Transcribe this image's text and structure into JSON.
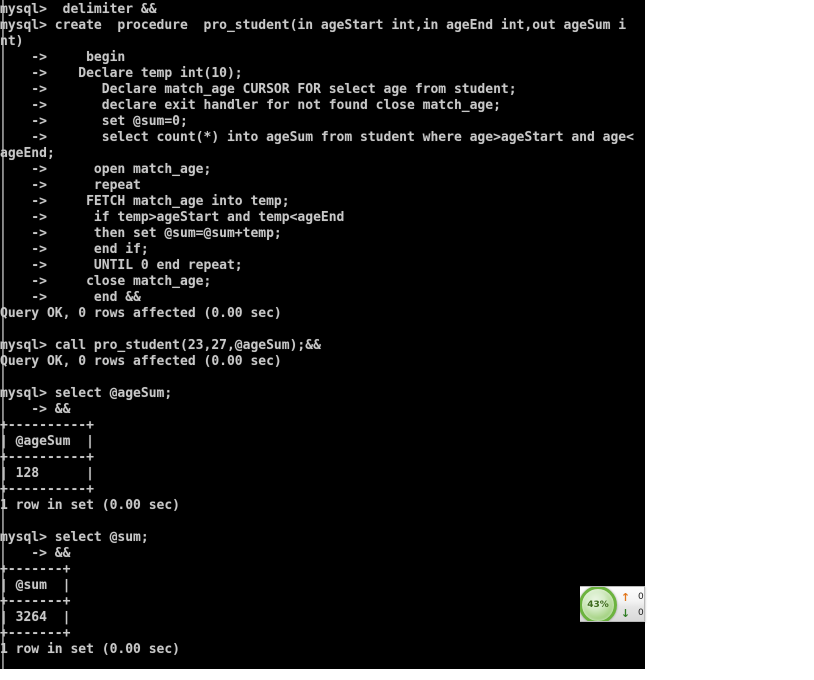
{
  "console": {
    "title": "mysql command line client",
    "prompt": "mysql>",
    "continuation_prompt": "->",
    "text_color": "#c8c8c8",
    "background_color": "#000000",
    "lines": [
      "mysql>  delimiter &&",
      "mysql> create  procedure  pro_student(in ageStart int,in ageEnd int,out ageSum i",
      "nt)",
      "    ->     begin",
      "    ->    Declare temp int(10);",
      "    ->       Declare match_age CURSOR FOR select age from student;",
      "    ->       declare exit handler for not found close match_age;",
      "    ->       set @sum=0;",
      "    ->       select count(*) into ageSum from student where age>ageStart and age<",
      "ageEnd;",
      "    ->      open match_age;",
      "    ->      repeat",
      "    ->     FETCH match_age into temp;",
      "    ->      if temp>ageStart and temp<ageEnd",
      "    ->      then set @sum=@sum+temp;",
      "    ->      end if;",
      "    ->      UNTIL 0 end repeat;",
      "    ->     close match_age;",
      "    ->      end &&",
      "Query OK, 0 rows affected (0.00 sec)",
      "",
      "mysql> call pro_student(23,27,@ageSum);&&",
      "Query OK, 0 rows affected (0.00 sec)",
      "",
      "mysql> select @ageSum;",
      "    -> &&",
      "+----------+",
      "| @ageSum  |",
      "+----------+",
      "| 128      |",
      "+----------+",
      "1 row in set (0.00 sec)",
      "",
      "mysql> select @sum;",
      "    -> &&",
      "+-------+",
      "| @sum  |",
      "+-------+",
      "| 3264  |",
      "+-------+",
      "1 row in set (0.00 sec)"
    ]
  },
  "monitor_widget": {
    "gauge_label": "43%",
    "gauge_color": "#6cb33f",
    "upload": {
      "arrow": "↑",
      "value": "0",
      "color": "#e2761b"
    },
    "download": {
      "arrow": "↓",
      "value": "0",
      "color": "#2f7d24"
    }
  }
}
